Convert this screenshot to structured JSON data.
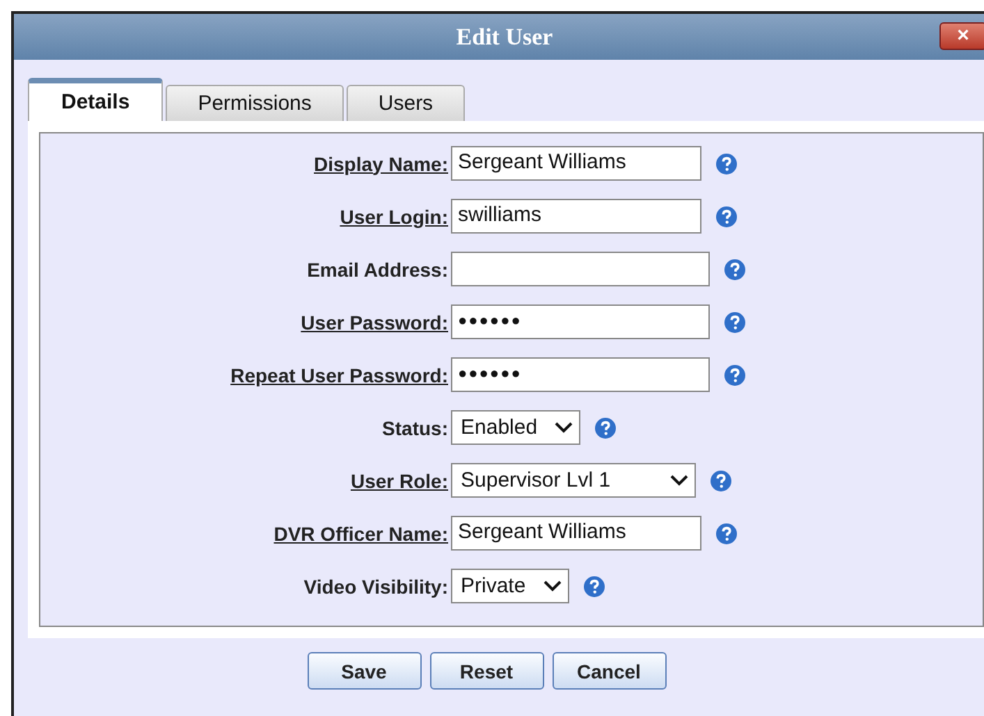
{
  "window": {
    "title": "Edit User",
    "close": "×"
  },
  "tabs": [
    {
      "label": "Details",
      "selected": true
    },
    {
      "label": "Permissions",
      "selected": false
    },
    {
      "label": "Users",
      "selected": false
    }
  ],
  "fields": [
    {
      "kind": "text",
      "label": "Display Name:",
      "linked": true,
      "value": "Sergeant Williams"
    },
    {
      "kind": "text",
      "label": "User Login:",
      "linked": true,
      "value": "swilliams"
    },
    {
      "kind": "text",
      "label": "Email Address:",
      "linked": false
    },
    {
      "kind": "password",
      "label": "User Password:",
      "linked": true,
      "value": "●●●●●●"
    },
    {
      "kind": "password",
      "label": "Repeat User Password:",
      "linked": true,
      "value": "●●●●●●"
    },
    {
      "kind": "select",
      "label": "Status:",
      "linked": false,
      "value": "Enabled"
    },
    {
      "kind": "select",
      "label": "User Role:",
      "linked": true,
      "value": "Supervisor Lvl 1"
    },
    {
      "kind": "text",
      "label": "DVR Officer Name:",
      "linked": true,
      "value": "Sergeant Williams"
    },
    {
      "kind": "select",
      "label": "Video Visibility:",
      "linked": false,
      "value": "Private"
    }
  ],
  "buttons": [
    "Save",
    "Reset",
    "Cancel"
  ]
}
